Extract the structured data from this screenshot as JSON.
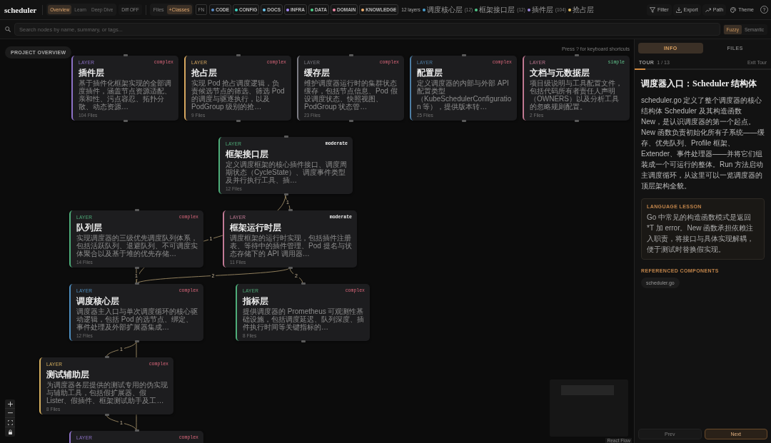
{
  "app": {
    "title": "scheduler"
  },
  "toolbar": {
    "view_modes": [
      {
        "label": "Overview",
        "selected": true
      },
      {
        "label": "Learn",
        "selected": false
      },
      {
        "label": "Deep Dive",
        "selected": false
      }
    ],
    "diff_toggle": {
      "label": "Diff OFF"
    },
    "detail_modes": [
      {
        "label": "Files",
        "selected": false
      },
      {
        "label": "+Classes",
        "selected": true
      }
    ],
    "fn_toggle": {
      "label": "FN"
    },
    "categories": [
      {
        "label": "CODE",
        "color": "#5b8ec9"
      },
      {
        "label": "CONFIG",
        "color": "#3ed6c4"
      },
      {
        "label": "DOCS",
        "color": "#6cc8f0"
      },
      {
        "label": "INFRA",
        "color": "#a78bfa"
      },
      {
        "label": "DATA",
        "color": "#4fd18b"
      },
      {
        "label": "DOMAIN",
        "color": "#f08aa8"
      },
      {
        "label": "KNOWLEDGE",
        "color": "#f0b070"
      }
    ],
    "layer_count": "12 layers",
    "layers": [
      {
        "name": "调度核心层",
        "count": "(12)",
        "color": "#4aa0d0"
      },
      {
        "name": "框架接口层",
        "count": "(12)",
        "color": "#4fc98a"
      },
      {
        "name": "插件层",
        "count": "(104)",
        "color": "#9a86e0"
      },
      {
        "name": "抢占层",
        "color": "#e8c060"
      }
    ],
    "actions": [
      {
        "kind": "filter",
        "label": "Filter"
      },
      {
        "kind": "export",
        "label": "Export"
      },
      {
        "kind": "path",
        "label": "Path"
      },
      {
        "kind": "theme",
        "label": "Theme"
      },
      {
        "kind": "help",
        "label": "?"
      }
    ]
  },
  "search": {
    "placeholder": "Search nodes by name, summary, or tags...",
    "modes": [
      {
        "label": "Fuzzy",
        "selected": true
      },
      {
        "label": "Semantic",
        "selected": false
      }
    ]
  },
  "canvas": {
    "overview_button": "PROJECT OVERVIEW",
    "shortcut_hint": "Press ? for keyboard shortcuts",
    "nodes": [
      {
        "tag": "LAYER",
        "complexity": {
          "label": "complex",
          "kind": "complex"
        },
        "title": "插件层",
        "description": "基于插件化框架实现的全部调度插件，涵盖节点资源适配、亲和性、污点容忍、拓扑分散、动态资源…",
        "files": "104 Files",
        "color": "#8e72c8"
      },
      {
        "tag": "LAYER",
        "complexity": {
          "label": "complex",
          "kind": "complex"
        },
        "title": "抢占层",
        "description": "实现 Pod 抢占调度逻辑，负责候选节点的筛选、筛选 Pod 的调度与驱逐执行，以及 PodGroup 级别的抢…",
        "files": "9 Files",
        "color": "#d6a760"
      },
      {
        "tag": "LAYER",
        "complexity": {
          "label": "complex",
          "kind": "complex"
        },
        "title": "缓存层",
        "description": "维护调度器运行时的集群状态缓存，包括节点信息、Pod 假设调度状态、快照视图、PodGroup 状态管…",
        "files": "23 Files",
        "color": "#7c7c84"
      },
      {
        "tag": "LAYER",
        "complexity": {
          "label": "complex",
          "kind": "complex"
        },
        "title": "配置层",
        "description": "定义调度器的内部与外部 API 配置类型（KubeSchedulerConfiguration 等），提供版本转…",
        "files": "25 Files",
        "color": "#4f7fa6"
      },
      {
        "tag": "LAYER",
        "complexity": {
          "label": "simple",
          "kind": "simple"
        },
        "title": "文档与元数据层",
        "description": "项目级说明与工具配置文件，包括代码所有者责任人声明（OWNERS）以及分析工具的忽略规则配置。",
        "files": "2 Files",
        "color": "#c07892"
      },
      {
        "tag": "LAYER",
        "complexity": {
          "label": "moderate",
          "kind": "moderate"
        },
        "title": "框架接口层",
        "description": "定义调度框架的核心插件接口、调度周期状态（CycleState）、调度事件类型及并行执行工具、插…",
        "files": "12 Files",
        "color": "#4fae7a"
      },
      {
        "tag": "LAYER",
        "complexity": {
          "label": "complex",
          "kind": "complex"
        },
        "title": "队列层",
        "description": "实现调度器的三级优先调度队列体系，包括活跃队列、退避队列、不可调度实体聚合以及基于堆的优先存储…",
        "files": "14 Files",
        "color": "#4fae7a"
      },
      {
        "tag": "LAYER",
        "complexity": {
          "label": "moderate",
          "kind": "moderate"
        },
        "title": "框架运行时层",
        "description": "调度框架的运行时实现，包括插件注册表、等待中的插件管理、Pod 提名与状态存储下的 API 调用器…",
        "files": "11 Files",
        "color": "#c27a96"
      },
      {
        "tag": "LAYER",
        "complexity": {
          "label": "complex",
          "kind": "complex"
        },
        "title": "调度核心层",
        "description": "调度器主入口与单次调度循环的核心驱动逻辑，包括 Pod 的选节点、绑定、事件处理及外部扩展器集成…",
        "files": "12 Files",
        "color": "#4f8fc0"
      },
      {
        "tag": "LAYER",
        "complexity": {
          "label": "complex",
          "kind": "complex"
        },
        "title": "指标层",
        "description": "提供调度器的 Prometheus 可观测性基础设施，包括调度延迟、队列深度、插件执行时间等关键指标的…",
        "files": "8 Files",
        "color": "#4fae7a"
      },
      {
        "tag": "LAYER",
        "complexity": {
          "label": "complex",
          "kind": "complex"
        },
        "title": "测试辅助层",
        "description": "为调度器各层提供的测试专用的伪实现与辅助工具，包括假扩展器、假 Lister、假插件、框架测试助手及工…",
        "files": "8 Files",
        "color": "#d6b060"
      },
      {
        "tag": "LAYER",
        "complexity": {
          "label": "complex",
          "kind": "complex"
        },
        "color": "#8e72c8"
      }
    ],
    "edges": [
      {
        "label": "1"
      },
      {
        "label": "1"
      },
      {
        "label": "1"
      },
      {
        "label": "2"
      },
      {
        "label": "2"
      },
      {
        "label": "1"
      },
      {
        "label": "1"
      }
    ],
    "attribution": "React Flow"
  },
  "panel": {
    "tabs": [
      {
        "label": "INFO",
        "selected": true
      },
      {
        "label": "FILES",
        "selected": false
      }
    ],
    "tour": {
      "label": "TOUR",
      "step": "1 / 13",
      "exit": "Exit Tour",
      "level": 0.077
    },
    "title": "调度器入口：Scheduler 结构体",
    "body": "scheduler.go 定义了整个调度器的核心结构体 Scheduler 及其构造函数 New，是认识调度器的第一个起点。New 函数负责初始化所有子系统——缓存、优先队列、Profile 框架、Extender、事件处理器——并将它们组装成一个可运行的整体。Run 方法启动主调度循环，从这里可以一览调度器的顶层架构全貌。",
    "lesson": {
      "heading": "LANGUAGE LESSON",
      "text": "Go 中常见的构造函数模式是返回 *T 加 error。New 函数承担依赖注入职责，将接口与具体实现解耦，便于测试时替换假实现。"
    },
    "references": {
      "heading": "REFERENCED COMPONENTS",
      "items": [
        "scheduler.go"
      ]
    },
    "nav": [
      {
        "label": "Prev",
        "disabled": true
      },
      {
        "label": "Next",
        "disabled": false
      }
    ]
  }
}
